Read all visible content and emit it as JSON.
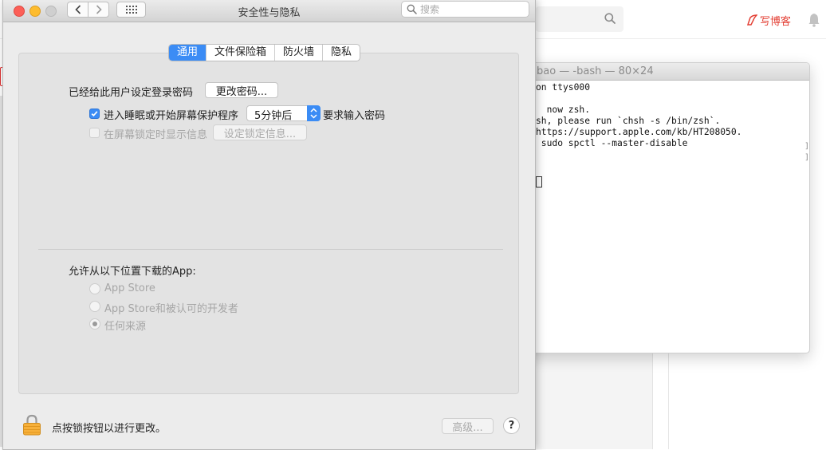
{
  "browser": {
    "write_blog_label": "写博客",
    "accent_color": "#e33e33"
  },
  "terminal": {
    "title": "bao — -bash — 80×24",
    "lines": [
      "on ttys000",
      "",
      "  now zsh.",
      "sh, please run `chsh -s /bin/zsh`.",
      "https://support.apple.com/kb/HT208050.",
      " sudo spctl --master-disable"
    ]
  },
  "window": {
    "title": "安全性与隐私",
    "search_placeholder": "搜索",
    "accent_color": "#3b8cf5"
  },
  "tabs": [
    {
      "label": "通用",
      "active": true
    },
    {
      "label": "文件保险箱",
      "active": false
    },
    {
      "label": "防火墙",
      "active": false
    },
    {
      "label": "隐私",
      "active": false
    }
  ],
  "general": {
    "password_set_label": "已经给此用户设定登录密码",
    "change_password_button": "更改密码...",
    "require_password_checkbox": {
      "prefix": "进入睡眠或开始屏幕保护程序",
      "checked": true
    },
    "require_password_delay": "5分钟后",
    "require_password_suffix": "要求输入密码",
    "lock_message_checkbox": {
      "label": "在屏幕锁定时显示信息",
      "checked": false,
      "disabled": true
    },
    "set_lock_message_button": "设定锁定信息..."
  },
  "downloads": {
    "heading": "允许从以下位置下载的App:",
    "options": [
      {
        "label": "App Store",
        "selected": false
      },
      {
        "label": "App Store和被认可的开发者",
        "selected": false
      },
      {
        "label": "任何来源",
        "selected": true
      }
    ]
  },
  "footer": {
    "lock_message": "点按锁按钮以进行更改。",
    "advanced_button": "高级...",
    "help_label": "?"
  }
}
